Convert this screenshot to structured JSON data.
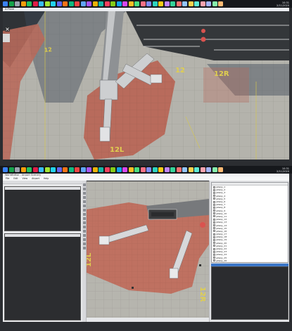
{
  "taskbar_icon_colors": [
    "#3b82f6",
    "#16a34a",
    "#9ca3af",
    "#f59e0b",
    "#22c55e",
    "#e11d48",
    "#38bdf8",
    "#a3e635",
    "#22d3ee",
    "#6366f1",
    "#f97316",
    "#10b981",
    "#ef4444",
    "#60a5fa",
    "#a855f7",
    "#eab308",
    "#14b8a6",
    "#f43f5e",
    "#84cc16",
    "#0ea5e9",
    "#d946ef",
    "#fbbf24",
    "#4ade80",
    "#fb7185",
    "#818cf8",
    "#2dd4bf",
    "#facc15",
    "#c084fc",
    "#34d399",
    "#f87171",
    "#93c5fd",
    "#fcd34d",
    "#5eead4",
    "#fda4af",
    "#a5b4fc",
    "#86efac",
    "#fdba74"
  ],
  "top_screen": {
    "taskbar": {
      "time": "10:31",
      "date": "2/11/2020"
    },
    "window_title": "X-Plane"
  },
  "sim_view": {
    "stand_labels": [
      "12",
      "12",
      "12L",
      "12R"
    ],
    "colors": {
      "concrete": "#b4b3ac",
      "apron_red": "#b86b5c",
      "taxiway": "#34373a"
    }
  },
  "bottom_screen": {
    "taskbar": {
      "time": "10:31",
      "date": "2/11/2020"
    },
    "editor_title": "WorldEditor - Airport Scenery",
    "menu": [
      "File",
      "Edit",
      "View",
      "Airport",
      "Help"
    ],
    "map_labels": [
      "12L",
      "12R"
    ],
    "status_text": "",
    "layers": [
      "jetway_1",
      "jetway_2",
      "jetway_3",
      "jetway_4",
      "jetway_5",
      "jetway_6",
      "jetway_7",
      "jetway_8",
      "jetway_9",
      "jetway_10",
      "jetway_11",
      "jetway_12",
      "jetway_13",
      "jetway_14",
      "jetway_15",
      "jetway_16",
      "jetway_17",
      "jetway_18",
      "jetway_19",
      "jetway_20",
      "jetway_21",
      "jetway_22",
      "jetway_23",
      "jetway_24",
      "jetway_25",
      "jetway_26"
    ]
  }
}
